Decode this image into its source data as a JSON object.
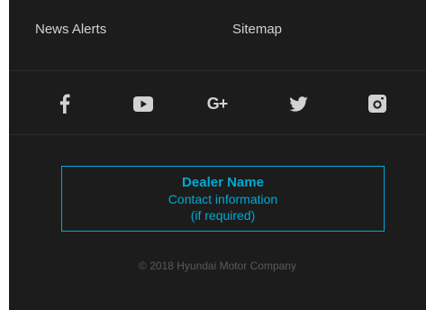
{
  "footer": {
    "links": {
      "news_alerts": "News Alerts",
      "sitemap": "Sitemap"
    },
    "social": [
      {
        "name": "facebook",
        "icon": "facebook-icon"
      },
      {
        "name": "youtube",
        "icon": "youtube-icon"
      },
      {
        "name": "google-plus",
        "icon": "google-plus-icon",
        "glyph": "G+"
      },
      {
        "name": "twitter",
        "icon": "twitter-icon"
      },
      {
        "name": "instagram",
        "icon": "instagram-icon"
      }
    ],
    "dealer": {
      "name": "Dealer Name",
      "contact": "Contact information",
      "note": "(if required)"
    },
    "copyright": "© 2018 Hyundai Motor Company"
  },
  "colors": {
    "background": "#1c1c1c",
    "page_background": "#ffffff",
    "link_text": "#d2d2d2",
    "icon": "#d2d2d2",
    "accent": "#00aad2",
    "divider": "#2b2b2b",
    "muted_text": "#5a5a5a"
  }
}
